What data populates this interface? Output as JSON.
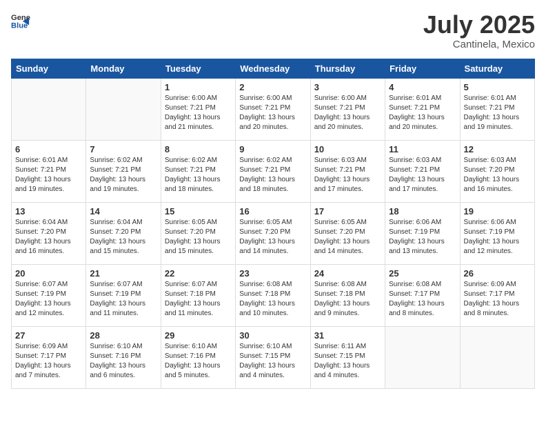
{
  "logo": {
    "general": "General",
    "blue": "Blue"
  },
  "header": {
    "month": "July 2025",
    "location": "Cantinela, Mexico"
  },
  "weekdays": [
    "Sunday",
    "Monday",
    "Tuesday",
    "Wednesday",
    "Thursday",
    "Friday",
    "Saturday"
  ],
  "weeks": [
    [
      {
        "day": "",
        "info": ""
      },
      {
        "day": "",
        "info": ""
      },
      {
        "day": "1",
        "info": "Sunrise: 6:00 AM\nSunset: 7:21 PM\nDaylight: 13 hours\nand 21 minutes."
      },
      {
        "day": "2",
        "info": "Sunrise: 6:00 AM\nSunset: 7:21 PM\nDaylight: 13 hours\nand 20 minutes."
      },
      {
        "day": "3",
        "info": "Sunrise: 6:00 AM\nSunset: 7:21 PM\nDaylight: 13 hours\nand 20 minutes."
      },
      {
        "day": "4",
        "info": "Sunrise: 6:01 AM\nSunset: 7:21 PM\nDaylight: 13 hours\nand 20 minutes."
      },
      {
        "day": "5",
        "info": "Sunrise: 6:01 AM\nSunset: 7:21 PM\nDaylight: 13 hours\nand 19 minutes."
      }
    ],
    [
      {
        "day": "6",
        "info": "Sunrise: 6:01 AM\nSunset: 7:21 PM\nDaylight: 13 hours\nand 19 minutes."
      },
      {
        "day": "7",
        "info": "Sunrise: 6:02 AM\nSunset: 7:21 PM\nDaylight: 13 hours\nand 19 minutes."
      },
      {
        "day": "8",
        "info": "Sunrise: 6:02 AM\nSunset: 7:21 PM\nDaylight: 13 hours\nand 18 minutes."
      },
      {
        "day": "9",
        "info": "Sunrise: 6:02 AM\nSunset: 7:21 PM\nDaylight: 13 hours\nand 18 minutes."
      },
      {
        "day": "10",
        "info": "Sunrise: 6:03 AM\nSunset: 7:21 PM\nDaylight: 13 hours\nand 17 minutes."
      },
      {
        "day": "11",
        "info": "Sunrise: 6:03 AM\nSunset: 7:21 PM\nDaylight: 13 hours\nand 17 minutes."
      },
      {
        "day": "12",
        "info": "Sunrise: 6:03 AM\nSunset: 7:20 PM\nDaylight: 13 hours\nand 16 minutes."
      }
    ],
    [
      {
        "day": "13",
        "info": "Sunrise: 6:04 AM\nSunset: 7:20 PM\nDaylight: 13 hours\nand 16 minutes."
      },
      {
        "day": "14",
        "info": "Sunrise: 6:04 AM\nSunset: 7:20 PM\nDaylight: 13 hours\nand 15 minutes."
      },
      {
        "day": "15",
        "info": "Sunrise: 6:05 AM\nSunset: 7:20 PM\nDaylight: 13 hours\nand 15 minutes."
      },
      {
        "day": "16",
        "info": "Sunrise: 6:05 AM\nSunset: 7:20 PM\nDaylight: 13 hours\nand 14 minutes."
      },
      {
        "day": "17",
        "info": "Sunrise: 6:05 AM\nSunset: 7:20 PM\nDaylight: 13 hours\nand 14 minutes."
      },
      {
        "day": "18",
        "info": "Sunrise: 6:06 AM\nSunset: 7:19 PM\nDaylight: 13 hours\nand 13 minutes."
      },
      {
        "day": "19",
        "info": "Sunrise: 6:06 AM\nSunset: 7:19 PM\nDaylight: 13 hours\nand 12 minutes."
      }
    ],
    [
      {
        "day": "20",
        "info": "Sunrise: 6:07 AM\nSunset: 7:19 PM\nDaylight: 13 hours\nand 12 minutes."
      },
      {
        "day": "21",
        "info": "Sunrise: 6:07 AM\nSunset: 7:19 PM\nDaylight: 13 hours\nand 11 minutes."
      },
      {
        "day": "22",
        "info": "Sunrise: 6:07 AM\nSunset: 7:18 PM\nDaylight: 13 hours\nand 11 minutes."
      },
      {
        "day": "23",
        "info": "Sunrise: 6:08 AM\nSunset: 7:18 PM\nDaylight: 13 hours\nand 10 minutes."
      },
      {
        "day": "24",
        "info": "Sunrise: 6:08 AM\nSunset: 7:18 PM\nDaylight: 13 hours\nand 9 minutes."
      },
      {
        "day": "25",
        "info": "Sunrise: 6:08 AM\nSunset: 7:17 PM\nDaylight: 13 hours\nand 8 minutes."
      },
      {
        "day": "26",
        "info": "Sunrise: 6:09 AM\nSunset: 7:17 PM\nDaylight: 13 hours\nand 8 minutes."
      }
    ],
    [
      {
        "day": "27",
        "info": "Sunrise: 6:09 AM\nSunset: 7:17 PM\nDaylight: 13 hours\nand 7 minutes."
      },
      {
        "day": "28",
        "info": "Sunrise: 6:10 AM\nSunset: 7:16 PM\nDaylight: 13 hours\nand 6 minutes."
      },
      {
        "day": "29",
        "info": "Sunrise: 6:10 AM\nSunset: 7:16 PM\nDaylight: 13 hours\nand 5 minutes."
      },
      {
        "day": "30",
        "info": "Sunrise: 6:10 AM\nSunset: 7:15 PM\nDaylight: 13 hours\nand 4 minutes."
      },
      {
        "day": "31",
        "info": "Sunrise: 6:11 AM\nSunset: 7:15 PM\nDaylight: 13 hours\nand 4 minutes."
      },
      {
        "day": "",
        "info": ""
      },
      {
        "day": "",
        "info": ""
      }
    ]
  ]
}
